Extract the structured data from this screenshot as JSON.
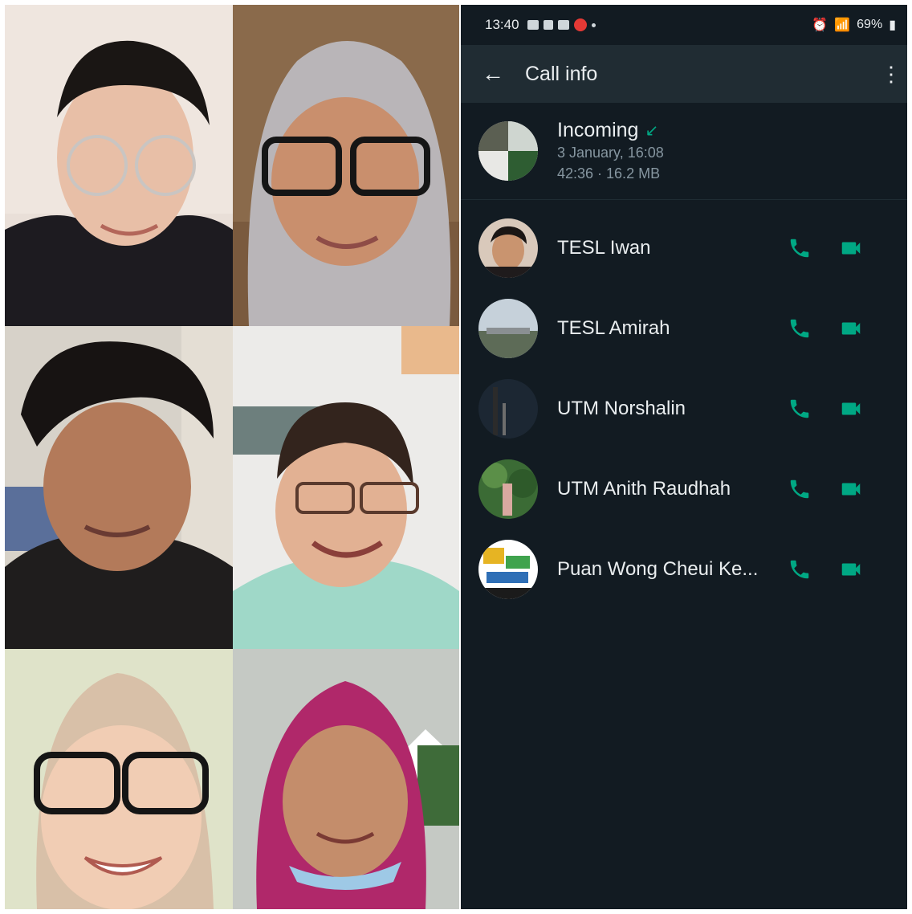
{
  "status_bar": {
    "time": "13:40",
    "battery": "69%"
  },
  "header": {
    "title": "Call info"
  },
  "call": {
    "direction": "Incoming",
    "date_time": "3 January, 16:08",
    "duration_size": "42:36 · 16.2 MB"
  },
  "participants": [
    {
      "name": "TESL Iwan"
    },
    {
      "name": "TESL Amirah"
    },
    {
      "name": "UTM Norshalin"
    },
    {
      "name": "UTM Anith Raudhah"
    },
    {
      "name": "Puan Wong Cheui Ke..."
    }
  ],
  "colors": {
    "accent": "#00a884",
    "background": "#121b22",
    "appbar": "#202c33",
    "secondary_text": "#8696a0"
  },
  "icons": {
    "back": "arrow-left-icon",
    "menu": "more-vertical-icon",
    "incoming": "incoming-arrow-icon",
    "voice": "phone-icon",
    "video": "video-camera-icon"
  }
}
